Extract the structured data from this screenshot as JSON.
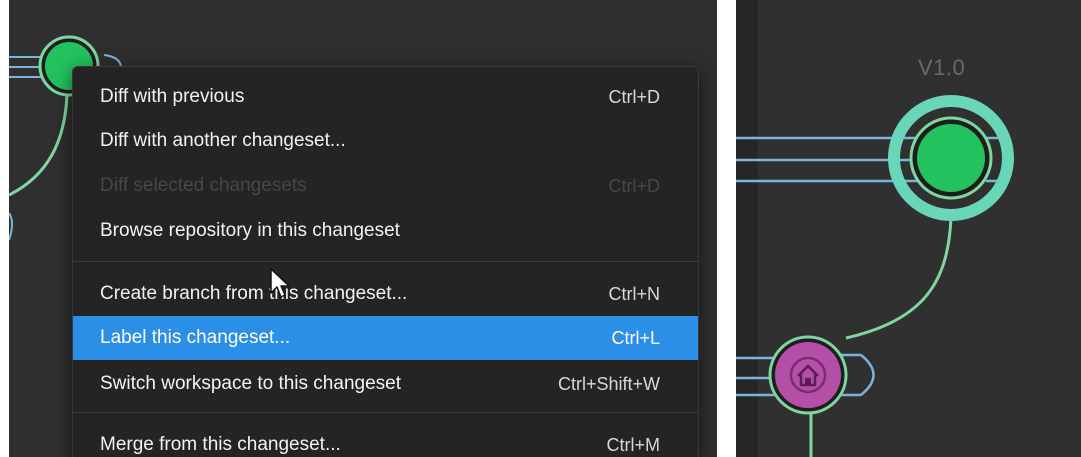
{
  "context_menu": {
    "items": [
      {
        "label": "Diff with previous",
        "shortcut": "Ctrl+D",
        "enabled": true
      },
      {
        "label": "Diff with another changeset...",
        "shortcut": "",
        "enabled": true
      },
      {
        "label": "Diff selected changesets",
        "shortcut": "Ctrl+D",
        "enabled": false
      },
      {
        "label": "Browse repository in this changeset",
        "shortcut": "",
        "enabled": true
      },
      {
        "label": "Create branch from this changeset...",
        "shortcut": "Ctrl+N",
        "enabled": true
      },
      {
        "label": "Label this changeset...",
        "shortcut": "Ctrl+L",
        "enabled": true,
        "highlighted": true
      },
      {
        "label": "Switch workspace to this changeset",
        "shortcut": "Ctrl+Shift+W",
        "enabled": true
      },
      {
        "label": "Merge from this changeset...",
        "shortcut": "Ctrl+M",
        "enabled": true
      }
    ]
  },
  "branch_graph": {
    "version_label": "V1.0",
    "changeset_color": "#22c35e",
    "label_ring_color": "#6ad6b8",
    "home_changeset_color": "#b44fa8",
    "branch_line_color": "#7ab6dc",
    "link_line_color": "#7fd6a0"
  },
  "icons": {
    "cursor": "arrow-pointer-icon",
    "home": "home-icon"
  }
}
